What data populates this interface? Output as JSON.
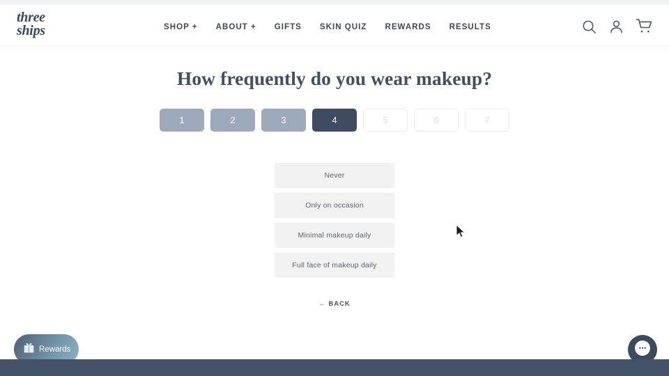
{
  "header": {
    "logo_line1": "three",
    "logo_line2": "ships",
    "nav": [
      {
        "label": "SHOP +",
        "name": "nav-shop"
      },
      {
        "label": "ABOUT +",
        "name": "nav-about"
      },
      {
        "label": "GIFTS",
        "name": "nav-gifts"
      },
      {
        "label": "SKIN QUIZ",
        "name": "nav-skin-quiz"
      },
      {
        "label": "REWARDS",
        "name": "nav-rewards"
      },
      {
        "label": "RESULTS",
        "name": "nav-results"
      }
    ],
    "icons": {
      "search": "search-icon",
      "account": "account-icon",
      "cart": "cart-icon"
    }
  },
  "quiz": {
    "title": "How frequently do you wear makeup?",
    "current_step": 4,
    "total_steps": 7,
    "steps": [
      {
        "label": "1",
        "state": "done"
      },
      {
        "label": "2",
        "state": "done"
      },
      {
        "label": "3",
        "state": "done"
      },
      {
        "label": "4",
        "state": "active"
      },
      {
        "label": "5",
        "state": "todo"
      },
      {
        "label": "6",
        "state": "todo"
      },
      {
        "label": "7",
        "state": "todo"
      }
    ],
    "options": [
      "Never",
      "Only on occasion",
      "Minimal makeup daily",
      "Full face of makeup daily"
    ],
    "back_label": "← BACK"
  },
  "widgets": {
    "rewards_label": "Rewards",
    "rewards_icon": "gift-icon",
    "chat_icon": "chat-bubble-icon"
  },
  "colors": {
    "heading": "#404f66",
    "step_done": "#9daabb",
    "step_active": "#3e4c61",
    "option_bg": "#f2f2f2",
    "footer": "#45536a"
  }
}
